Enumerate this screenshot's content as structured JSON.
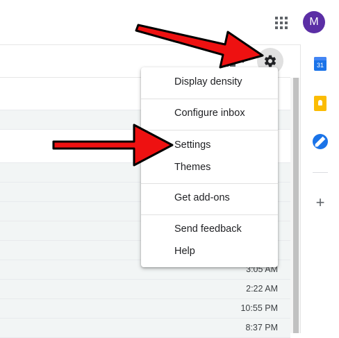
{
  "header": {
    "apps_icon": "apps-grid-icon",
    "avatar_letter": "M",
    "avatar_color": "#5b2ea5"
  },
  "toolbar": {
    "split_pane_icon": "split-pane-icon",
    "settings_icon": "gear-icon"
  },
  "settings_menu": {
    "items": [
      {
        "label": "Display density"
      },
      {
        "label": "Configure inbox"
      },
      {
        "label": "Settings"
      },
      {
        "label": "Themes"
      },
      {
        "label": "Get add-ons"
      },
      {
        "label": "Send feedback"
      },
      {
        "label": "Help"
      }
    ]
  },
  "message_list": {
    "times": [
      "3:05 AM",
      "2:22 AM",
      "10:55 PM",
      "8:37 PM"
    ]
  },
  "side_panel": {
    "calendar_day": "31",
    "icons": [
      "calendar-icon",
      "keep-icon",
      "tasks-icon",
      "plus-icon"
    ]
  },
  "annotation": {
    "arrow_color": "#ee1111"
  }
}
